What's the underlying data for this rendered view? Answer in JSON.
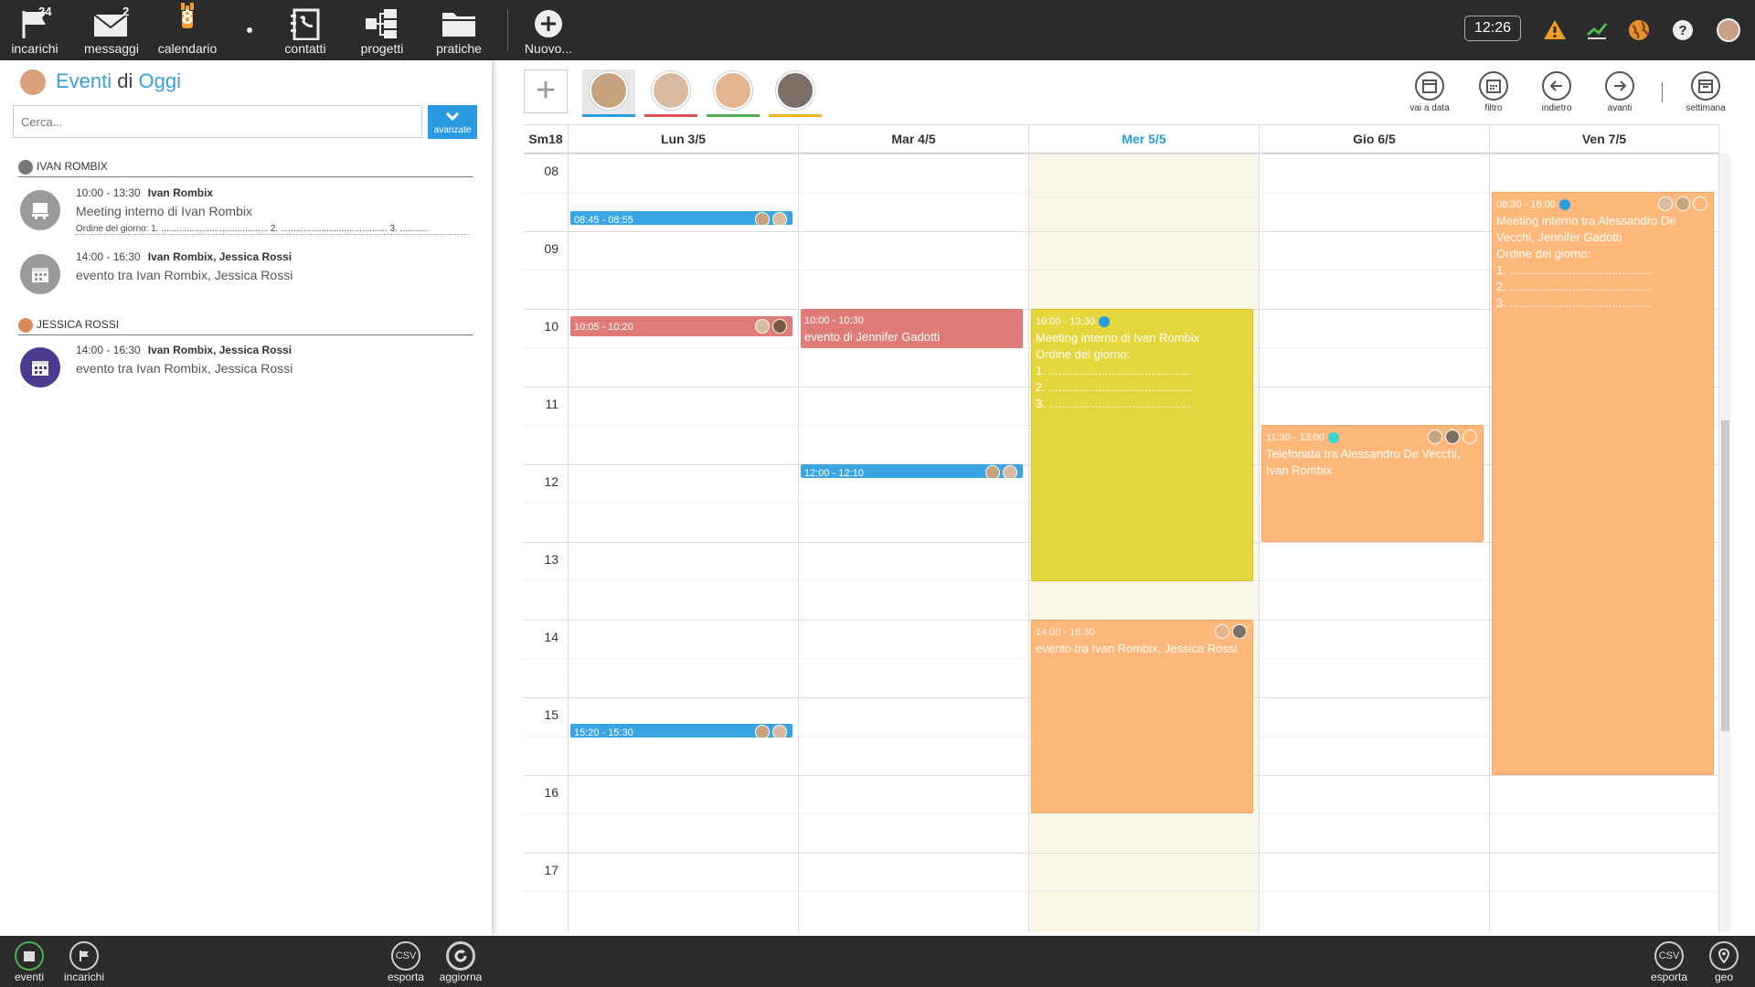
{
  "topbar": {
    "items": [
      {
        "label": "incarichi",
        "count": "24"
      },
      {
        "label": "messaggi",
        "count": "2"
      },
      {
        "label": "calendario",
        "day": "8"
      },
      {
        "label": "contatti"
      },
      {
        "label": "progetti"
      },
      {
        "label": "pratiche"
      },
      {
        "label": "Nuovo..."
      }
    ],
    "clock": "12:26",
    "accent": "#f0a030"
  },
  "left": {
    "title_a": "Eventi",
    "title_b": "di",
    "title_c": "Oggi",
    "search_placeholder": "Cerca...",
    "advanced_label": "avanzate",
    "groups": [
      {
        "name": "IVAN ROMBIX",
        "events": [
          {
            "time": "10:00 - 13:30",
            "people": "Ivan Rombix",
            "desc": "Meeting interno di Ivan Rombix",
            "agenda": "Ordine del giorno: 1. .......................................... 2. .......................................... 3. ...........",
            "icon": "meeting-icon"
          },
          {
            "time": "14:00 - 16:30",
            "people": "Ivan Rombix, Jessica Rossi",
            "desc": "evento tra Ivan Rombix, Jessica Rossi",
            "icon": "calendar-icon"
          }
        ]
      },
      {
        "name": "JESSICA ROSSI",
        "events": [
          {
            "time": "14:00 - 16:30",
            "people": "Ivan Rombix, Jessica Rossi",
            "desc": "evento tra Ivan Rombix, Jessica Rossi",
            "icon": "calendar-icon"
          }
        ]
      }
    ]
  },
  "toolbar": {
    "resources": [
      {
        "color": "#2a9be0"
      },
      {
        "color": "#e05050"
      },
      {
        "color": "#4caf50"
      },
      {
        "color": "#f0b020"
      }
    ],
    "buttons": [
      {
        "label": "vai a data",
        "icon": "calendar-go-icon"
      },
      {
        "label": "filtro",
        "icon": "filter-icon"
      },
      {
        "label": "indietro",
        "icon": "arrow-left-icon"
      },
      {
        "label": "avanti",
        "icon": "arrow-right-icon"
      },
      {
        "label": "settimana",
        "icon": "week-icon"
      }
    ]
  },
  "calendar": {
    "week": "Sm18",
    "days": [
      "Lun 3/5",
      "Mar 4/5",
      "Mer 5/5",
      "Gio 6/5",
      "Ven 7/5"
    ],
    "today_index": 2,
    "hours": [
      "08",
      "09",
      "10",
      "11",
      "12",
      "13",
      "14",
      "15",
      "16",
      "17"
    ],
    "events": {
      "lun_a": {
        "time": "08:45 - 08:55"
      },
      "lun_b": {
        "time": "10:05 - 10:20"
      },
      "lun_c": {
        "time": "15:20 - 15:30"
      },
      "mar_a": {
        "time": "10:00 - 10:30",
        "desc": "evento di Jennifer Gadotti"
      },
      "mar_b": {
        "time": "12:00 - 12:10"
      },
      "mer_a": {
        "time": "10:00 - 13:30",
        "desc": "Meeting interno di Ivan Rombix",
        "l1": "Ordine del giorno:",
        "l2": "1. ...........................................",
        "l3": "2. ...........................................",
        "l4": "3. ..........................................."
      },
      "mer_b": {
        "time": "14:00 - 16:30",
        "desc": "evento tra Ivan Rombix, Jessica Rossi"
      },
      "gio_a": {
        "time": "11:30 - 13:00",
        "desc": "Telefonata tra Alessandro De Vecchi, Ivan Rombix"
      },
      "ven_a": {
        "time": "08:30 - 16:00",
        "desc": "Meeting interno tra Alessandro De Vecchi, Jennifer Gadotti",
        "l1": "Ordine del giorno:",
        "l2": "1. ...........................................",
        "l3": "2. ...........................................",
        "l4": "3. ..........................................."
      }
    }
  },
  "bottombar": {
    "left": [
      {
        "label": "eventi"
      },
      {
        "label": "incarichi"
      }
    ],
    "mid": [
      {
        "label": "esporta"
      },
      {
        "label": "aggiorna"
      }
    ],
    "right": [
      {
        "label": "esporta"
      },
      {
        "label": "geo"
      }
    ]
  }
}
